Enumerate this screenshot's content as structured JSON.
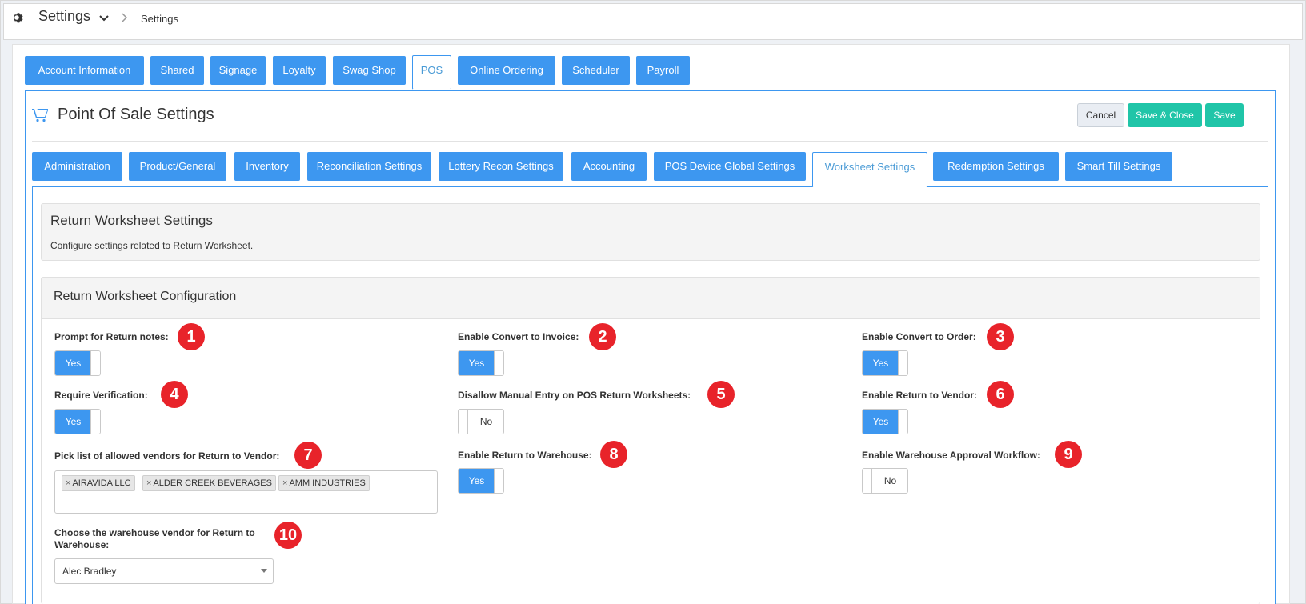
{
  "header": {
    "title": "Settings",
    "breadcrumb": "Settings"
  },
  "tabs": [
    "Account Information",
    "Shared",
    "Signage",
    "Loyalty",
    "Swag Shop",
    "POS",
    "Online Ordering",
    "Scheduler",
    "Payroll"
  ],
  "page": {
    "title": "Point Of Sale Settings",
    "buttons": {
      "cancel": "Cancel",
      "save_close": "Save & Close",
      "save": "Save"
    }
  },
  "subtabs": [
    "Administration",
    "Product/General",
    "Inventory",
    "Reconciliation Settings",
    "Lottery Recon Settings",
    "Accounting",
    "POS Device Global Settings",
    "Worksheet Settings",
    "Redemption Settings",
    "Smart Till Settings"
  ],
  "info": {
    "title": "Return Worksheet Settings",
    "subtitle": "Configure settings related to Return Worksheet."
  },
  "config": {
    "title": "Return Worksheet Configuration",
    "fields": [
      {
        "label": "Prompt for Return notes:",
        "badge": "1",
        "value": "Yes"
      },
      {
        "label": "Enable Convert to Invoice:",
        "badge": "2",
        "value": "Yes"
      },
      {
        "label": "Enable Convert to Order:",
        "badge": "3",
        "value": "Yes"
      },
      {
        "label": "Require Verification:",
        "badge": "4",
        "value": "Yes"
      },
      {
        "label": "Disallow Manual Entry on POS Return Worksheets:",
        "badge": "5",
        "value": "No"
      },
      {
        "label": "Enable Return to Vendor:",
        "badge": "6",
        "value": "Yes"
      },
      {
        "label": "Pick list of allowed vendors for Return to Vendor:",
        "badge": "7"
      },
      {
        "label": "Enable Return to Warehouse:",
        "badge": "8",
        "value": "Yes"
      },
      {
        "label": "Enable Warehouse Approval Workflow:",
        "badge": "9",
        "value": "No"
      },
      {
        "label_line1": "Choose the warehouse vendor for Return to",
        "label_line2": "Warehouse:",
        "badge": "10"
      }
    ],
    "vendors": [
      "AIRAVIDA LLC",
      "ALDER CREEK BEVERAGES",
      "AMM INDUSTRIES"
    ],
    "chip_remove": "×",
    "warehouse_vendor": "Alec Bradley"
  },
  "colors": {
    "primary": "#3d97f0",
    "teal": "#20c5a8",
    "badge": "#e8232a"
  },
  "icons": [
    "gear-icon",
    "chevron-down-icon",
    "chevron-right-icon",
    "cart-plus-icon",
    "caret-down-icon"
  ]
}
